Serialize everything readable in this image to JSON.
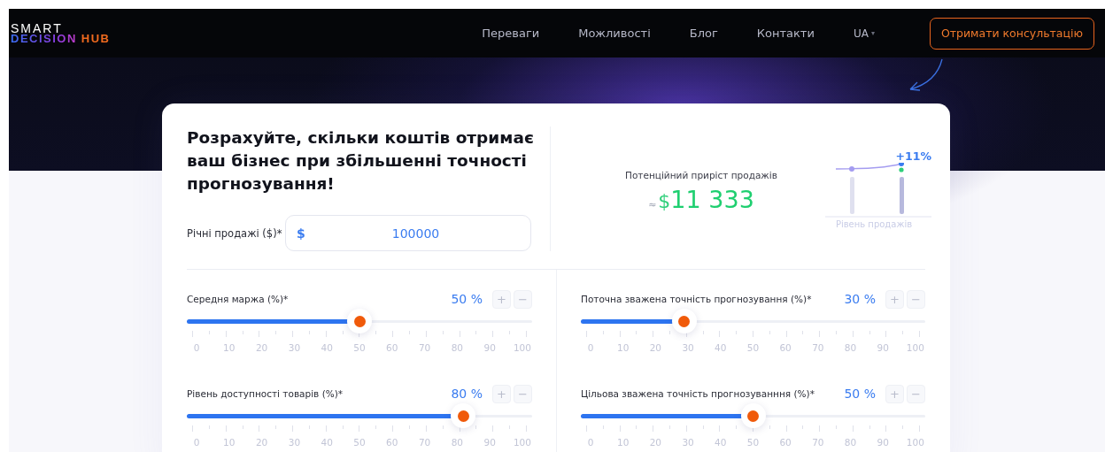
{
  "logo": {
    "line_1": "SMART",
    "line_2a": "DECISION",
    "line_2b": "HUB"
  },
  "nav": {
    "items": [
      "Переваги",
      "Можливості",
      "Блог",
      "Контакти"
    ],
    "language": "UA",
    "language_caret": "▾",
    "cta": "Отримати консультацію"
  },
  "calculator": {
    "heading": "Розрахуйте, скільки коштів отримає ваш бізнес при збільшенні точності прогнозування!",
    "annual_sales": {
      "label": "Річні продажі ($)*",
      "currency": "$",
      "value": "100000"
    },
    "result": {
      "label": "Потенційний приріст продажів",
      "approx": "≈",
      "currency": "$",
      "amount": "11 333",
      "growth": "+11%",
      "chart_label": "Рівень продажів"
    },
    "sliders": [
      {
        "label": "Середня маржа (%)*",
        "value": "50",
        "unit": "%",
        "level": 0.5,
        "plus": "+",
        "minus": "−",
        "scale": [
          "0",
          "10",
          "20",
          "30",
          "40",
          "50",
          "60",
          "70",
          "80",
          "90",
          "100"
        ]
      },
      {
        "label": "Поточна зважена точність прогнозування (%)*",
        "value": "30",
        "unit": "%",
        "level": 0.3,
        "plus": "+",
        "minus": "−",
        "scale": [
          "0",
          "10",
          "20",
          "30",
          "40",
          "50",
          "60",
          "70",
          "80",
          "90",
          "100"
        ]
      },
      {
        "label": "Рівень доступності товарів (%)*",
        "value": "80",
        "unit": "%",
        "level": 0.8,
        "plus": "+",
        "minus": "−",
        "scale": [
          "0",
          "10",
          "20",
          "30",
          "40",
          "50",
          "60",
          "70",
          "80",
          "90",
          "100"
        ]
      },
      {
        "label": "Цільова зважена точність прогнозуванння (%)*",
        "value": "50",
        "unit": "%",
        "level": 0.5,
        "plus": "+",
        "minus": "−",
        "scale": [
          "0",
          "10",
          "20",
          "30",
          "40",
          "50",
          "60",
          "70",
          "80",
          "90",
          "100"
        ]
      }
    ]
  }
}
